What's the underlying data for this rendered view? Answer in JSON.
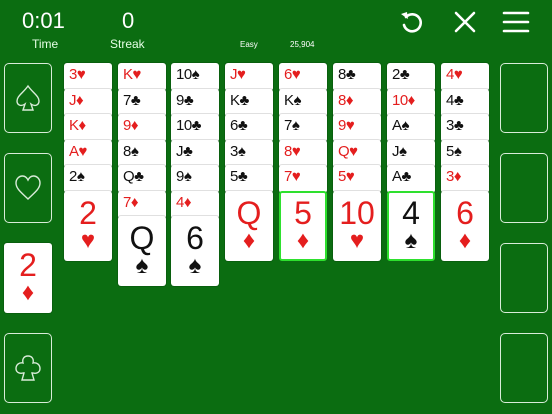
{
  "hud": {
    "time_value": "0:01",
    "time_label": "Time",
    "streak_value": "0",
    "streak_label": "Streak",
    "difficulty": "Easy",
    "deal_number": "25,904"
  },
  "toolbar": {
    "undo_icon": "undo-icon",
    "close_icon": "close-icon",
    "menu_icon": "hamburger-menu-icon"
  },
  "colors": {
    "felt": "#0b6d11",
    "red_suit": "#e41e1e",
    "black_suit": "#111111",
    "highlight": "#2ee02e"
  },
  "foundations": [
    {
      "slot_suit": "♠",
      "top_card": null
    },
    {
      "slot_suit": "♥",
      "top_card": null
    },
    {
      "slot_suit": "♦",
      "top_card": {
        "rank": "2",
        "suit": "♦"
      }
    },
    {
      "slot_suit": "♣",
      "top_card": null
    }
  ],
  "tableau": [
    {
      "cards": [
        {
          "rank": "3",
          "suit": "♥"
        },
        {
          "rank": "J",
          "suit": "♦"
        },
        {
          "rank": "K",
          "suit": "♦"
        },
        {
          "rank": "A",
          "suit": "♥"
        },
        {
          "rank": "2",
          "suit": "♠"
        },
        {
          "rank": "2",
          "suit": "♥"
        }
      ]
    },
    {
      "cards": [
        {
          "rank": "K",
          "suit": "♥"
        },
        {
          "rank": "7",
          "suit": "♣"
        },
        {
          "rank": "9",
          "suit": "♦"
        },
        {
          "rank": "8",
          "suit": "♠"
        },
        {
          "rank": "Q",
          "suit": "♣"
        },
        {
          "rank": "7",
          "suit": "♦"
        },
        {
          "rank": "Q",
          "suit": "♠"
        }
      ]
    },
    {
      "cards": [
        {
          "rank": "10",
          "suit": "♠"
        },
        {
          "rank": "9",
          "suit": "♣"
        },
        {
          "rank": "10",
          "suit": "♣"
        },
        {
          "rank": "J",
          "suit": "♣"
        },
        {
          "rank": "9",
          "suit": "♠"
        },
        {
          "rank": "4",
          "suit": "♦"
        },
        {
          "rank": "6",
          "suit": "♠"
        }
      ]
    },
    {
      "cards": [
        {
          "rank": "J",
          "suit": "♥"
        },
        {
          "rank": "K",
          "suit": "♣"
        },
        {
          "rank": "6",
          "suit": "♣"
        },
        {
          "rank": "3",
          "suit": "♠"
        },
        {
          "rank": "5",
          "suit": "♣"
        },
        {
          "rank": "Q",
          "suit": "♦"
        }
      ]
    },
    {
      "cards": [
        {
          "rank": "6",
          "suit": "♥"
        },
        {
          "rank": "K",
          "suit": "♠"
        },
        {
          "rank": "7",
          "suit": "♠"
        },
        {
          "rank": "8",
          "suit": "♥"
        },
        {
          "rank": "7",
          "suit": "♥"
        },
        {
          "rank": "5",
          "suit": "♦",
          "highlighted": true
        }
      ]
    },
    {
      "cards": [
        {
          "rank": "8",
          "suit": "♣"
        },
        {
          "rank": "8",
          "suit": "♦"
        },
        {
          "rank": "9",
          "suit": "♥"
        },
        {
          "rank": "Q",
          "suit": "♥"
        },
        {
          "rank": "5",
          "suit": "♥"
        },
        {
          "rank": "10",
          "suit": "♥"
        }
      ]
    },
    {
      "cards": [
        {
          "rank": "2",
          "suit": "♣"
        },
        {
          "rank": "10",
          "suit": "♦"
        },
        {
          "rank": "A",
          "suit": "♠"
        },
        {
          "rank": "J",
          "suit": "♠"
        },
        {
          "rank": "A",
          "suit": "♣"
        },
        {
          "rank": "4",
          "suit": "♠",
          "highlighted": true
        }
      ]
    },
    {
      "cards": [
        {
          "rank": "4",
          "suit": "♥"
        },
        {
          "rank": "4",
          "suit": "♣"
        },
        {
          "rank": "3",
          "suit": "♣"
        },
        {
          "rank": "5",
          "suit": "♠"
        },
        {
          "rank": "3",
          "suit": "♦"
        },
        {
          "rank": "6",
          "suit": "♦"
        }
      ]
    }
  ],
  "free_cells": [
    null,
    null,
    null,
    null
  ]
}
